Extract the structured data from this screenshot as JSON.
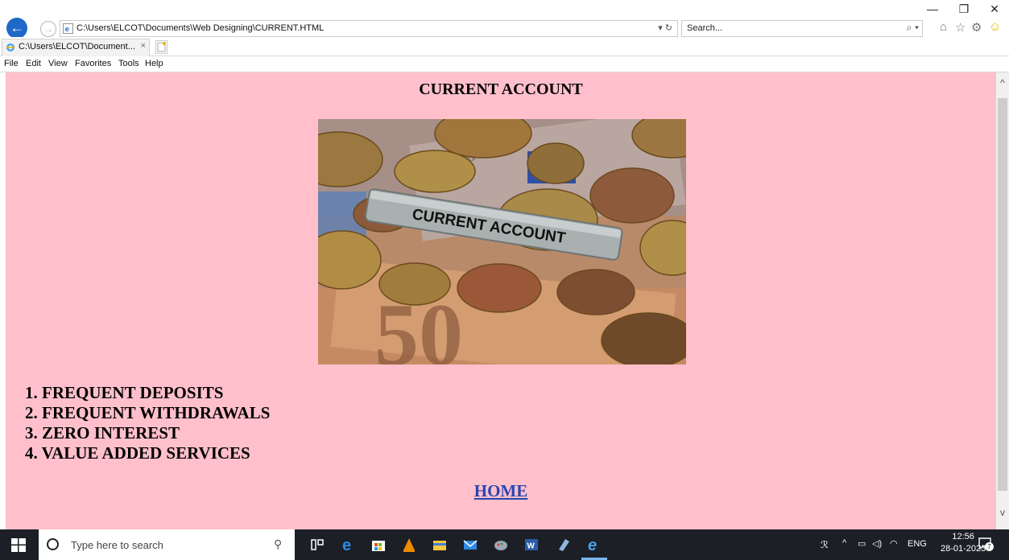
{
  "browser": {
    "address_url": "C:\\Users\\ELCOT\\Documents\\Web Designing\\CURRENT.HTML",
    "address_tools": "▾ ↻",
    "search_placeholder": "Search...",
    "search_icon": "⌕ ▾",
    "tab_label": "C:\\Users\\ELCOT\\Document...",
    "tab_close": "×",
    "window_controls": {
      "minimize": "—",
      "restore": "❐",
      "close": "✕"
    },
    "toolbar_icons": {
      "home": "⌂",
      "favorites": "☆",
      "settings": "⚙",
      "smiley": "☺"
    },
    "menu": [
      "File",
      "Edit",
      "View",
      "Favorites",
      "Tools",
      "Help"
    ]
  },
  "page": {
    "title": "CURRENT ACCOUNT",
    "image_caption": "CURRENT ACCOUNT",
    "features": [
      "1. FREQUENT DEPOSITS",
      "2. FREQUENT WITHDRAWALS",
      "3. ZERO INTEREST",
      "4. VALUE ADDED SERVICES"
    ],
    "home_link": "HOME",
    "background_color": "#ffc0cb",
    "link_color": "#2a45b3"
  },
  "taskbar": {
    "search_placeholder": "Type here to search",
    "tray_language": "ENG",
    "time": "12:56",
    "date": "28-01-2023",
    "notification_count": "7",
    "apps": [
      "task-view",
      "edge",
      "store",
      "vlc",
      "file-explorer",
      "mail",
      "paint",
      "word",
      "app",
      "internet-explorer"
    ]
  }
}
